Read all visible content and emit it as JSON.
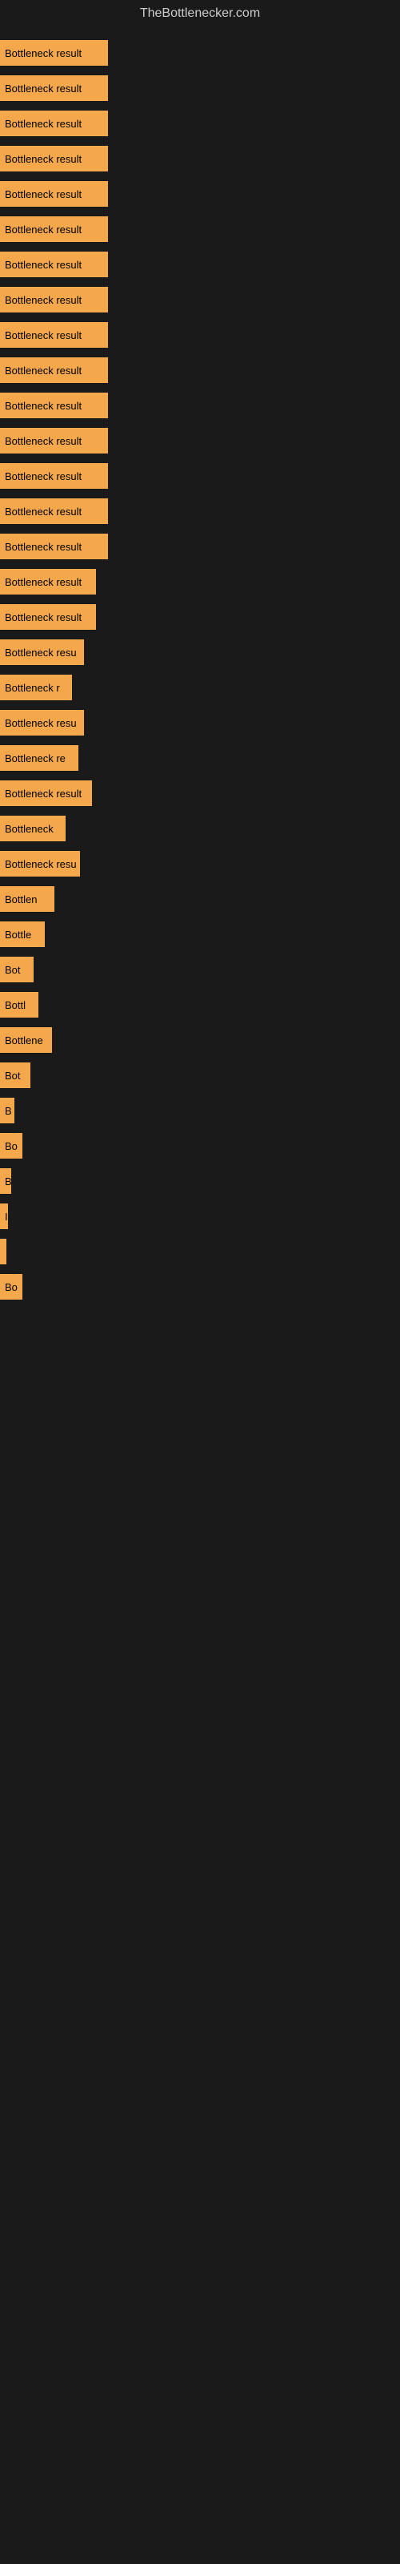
{
  "site": {
    "title": "TheBottlenecker.com"
  },
  "bars": [
    {
      "label": "Bottleneck result",
      "width": 135
    },
    {
      "label": "Bottleneck result",
      "width": 135
    },
    {
      "label": "Bottleneck result",
      "width": 135
    },
    {
      "label": "Bottleneck result",
      "width": 135
    },
    {
      "label": "Bottleneck result",
      "width": 135
    },
    {
      "label": "Bottleneck result",
      "width": 135
    },
    {
      "label": "Bottleneck result",
      "width": 135
    },
    {
      "label": "Bottleneck result",
      "width": 135
    },
    {
      "label": "Bottleneck result",
      "width": 135
    },
    {
      "label": "Bottleneck result",
      "width": 135
    },
    {
      "label": "Bottleneck result",
      "width": 135
    },
    {
      "label": "Bottleneck result",
      "width": 135
    },
    {
      "label": "Bottleneck result",
      "width": 135
    },
    {
      "label": "Bottleneck result",
      "width": 135
    },
    {
      "label": "Bottleneck result",
      "width": 135
    },
    {
      "label": "Bottleneck result",
      "width": 120
    },
    {
      "label": "Bottleneck result",
      "width": 120
    },
    {
      "label": "Bottleneck resu",
      "width": 105
    },
    {
      "label": "Bottleneck r",
      "width": 90
    },
    {
      "label": "Bottleneck resu",
      "width": 105
    },
    {
      "label": "Bottleneck re",
      "width": 98
    },
    {
      "label": "Bottleneck result",
      "width": 115
    },
    {
      "label": "Bottleneck",
      "width": 82
    },
    {
      "label": "Bottleneck resu",
      "width": 100
    },
    {
      "label": "Bottlen",
      "width": 68
    },
    {
      "label": "Bottle",
      "width": 56
    },
    {
      "label": "Bot",
      "width": 42
    },
    {
      "label": "Bottl",
      "width": 48
    },
    {
      "label": "Bottlene",
      "width": 65
    },
    {
      "label": "Bot",
      "width": 38
    },
    {
      "label": "B",
      "width": 18
    },
    {
      "label": "Bo",
      "width": 28
    },
    {
      "label": "B",
      "width": 14
    },
    {
      "label": "I",
      "width": 10
    },
    {
      "label": "",
      "width": 8
    },
    {
      "label": "Bo",
      "width": 28
    }
  ]
}
